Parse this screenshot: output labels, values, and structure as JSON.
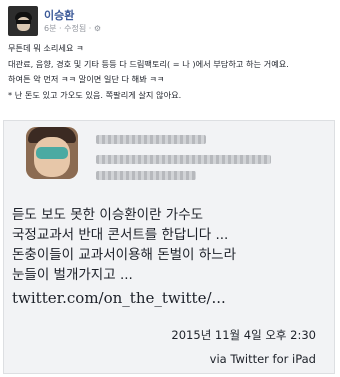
{
  "post": {
    "author": "이승환",
    "time": "6분",
    "edited": "수정됨",
    "lines": [
      "무튼데 뭐 소리세요 ㅋ",
      "대관료, 음향, 경호 및 기타 등등 다 드림팩토리( = 나 )에서 부담하고 하는 거예요.",
      "하여튼 악 먼저 ㅋㅋ 말이면 일단 다 해봐 ㅋㅋ",
      "* 난 돈도 있고 가오도 있음. 쪽팔리게 살지 않아요."
    ]
  },
  "tweet": {
    "lines": [
      "듣도 보도 못한  이승환이란 가수도",
      "국정교과서 반대 콘서트를 한답니다 ...",
      "돈충이들이 교과서이용해 돈벌이 하느라",
      "눈들이 벌개가지고 ..."
    ],
    "link": "twitter.com/on_the_twitte/...",
    "date": "2015년 11월 4일 오후 2:30",
    "via": "via Twitter for iPad"
  },
  "icons": {
    "privacy": "gear-icon"
  }
}
